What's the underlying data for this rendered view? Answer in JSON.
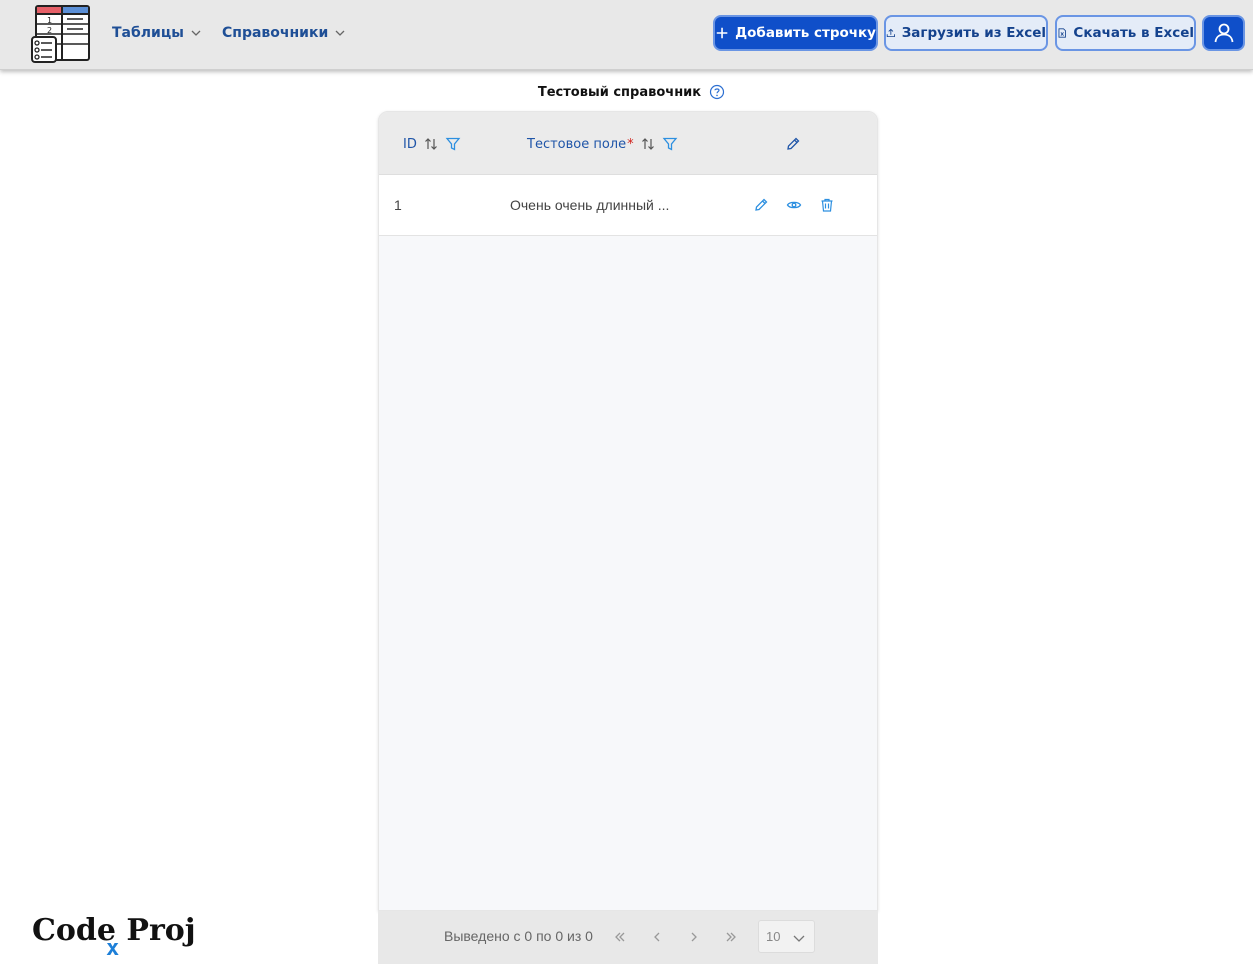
{
  "header": {
    "menu": [
      {
        "label": "Таблицы"
      },
      {
        "label": "Справочники"
      }
    ],
    "buttons": {
      "add_row": "Добавить строчку",
      "upload_excel": "Загрузить из Excel",
      "download_excel": "Скачать в Excel"
    }
  },
  "page": {
    "title": "Тестовый справочник"
  },
  "table": {
    "columns": [
      {
        "label": "ID"
      },
      {
        "label": "Тестовое поле",
        "required_mark": "*"
      }
    ],
    "rows": [
      {
        "id": "1",
        "field": "Очень очень длинный ..."
      }
    ]
  },
  "pagination": {
    "info": "Выведено с 0 по 0 из 0",
    "page_size": "10"
  },
  "watermark": {
    "text": "Code Proj",
    "x": "x"
  },
  "colors": {
    "primary": "#0f4fc9",
    "link": "#1f55a8",
    "icon": "#2c8fe0",
    "required": "#d0201a"
  }
}
